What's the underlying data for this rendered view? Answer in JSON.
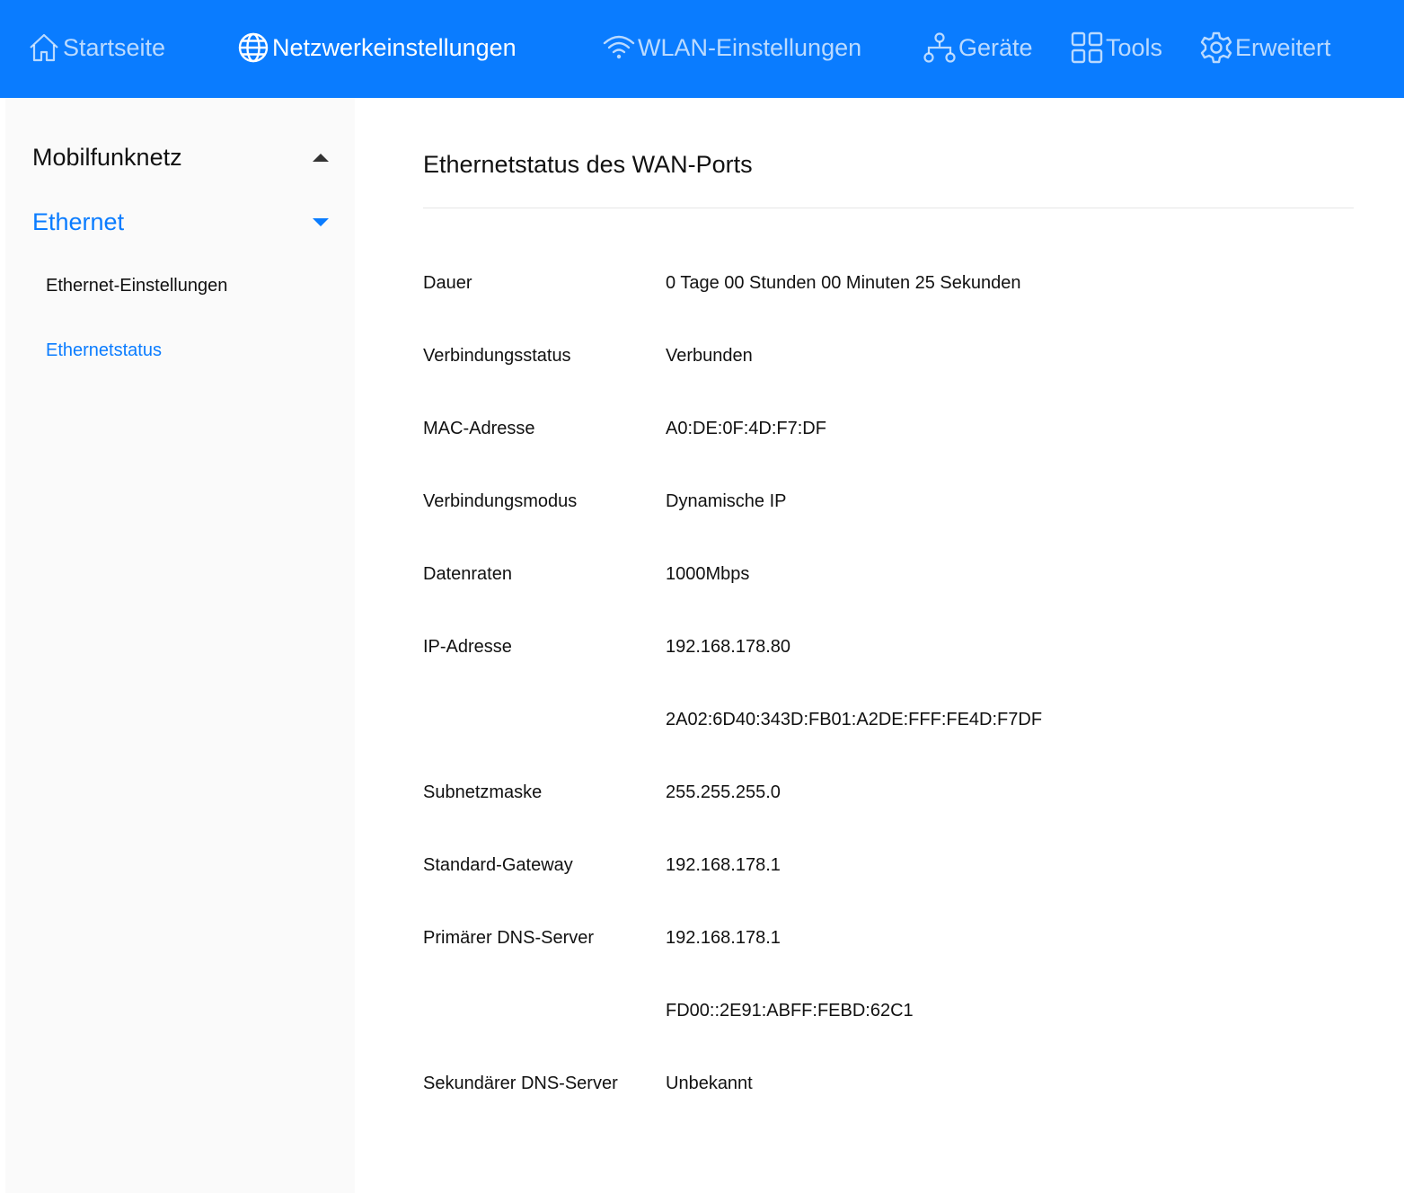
{
  "nav": {
    "items": [
      {
        "label": "Startseite",
        "icon": "home-icon"
      },
      {
        "label": "Netzwerkeinstellungen",
        "icon": "globe-icon"
      },
      {
        "label": "WLAN-Einstellungen",
        "icon": "wifi-icon"
      },
      {
        "label": "Geräte",
        "icon": "devices-icon"
      },
      {
        "label": "Tools",
        "icon": "grid-icon"
      },
      {
        "label": "Erweitert",
        "icon": "gear-icon"
      }
    ],
    "active": "Netzwerkeinstellungen"
  },
  "sidebar": {
    "groups": [
      {
        "label": "Mobilfunknetz",
        "expanded": false
      },
      {
        "label": "Ethernet",
        "expanded": true
      }
    ],
    "subitems": [
      {
        "label": "Ethernet-Einstellungen"
      },
      {
        "label": "Ethernetstatus"
      }
    ],
    "active": "Ethernetstatus"
  },
  "main": {
    "title": "Ethernetstatus des WAN-Ports",
    "rows": [
      {
        "key": "Dauer",
        "value": "0 Tage 00 Stunden 00 Minuten 25 Sekunden"
      },
      {
        "key": "Verbindungsstatus",
        "value": "Verbunden"
      },
      {
        "key": "MAC-Adresse",
        "value": "A0:DE:0F:4D:F7:DF"
      },
      {
        "key": "Verbindungsmodus",
        "value": "Dynamische IP"
      },
      {
        "key": "Datenraten",
        "value": "1000Mbps"
      },
      {
        "key": "IP-Adresse",
        "value": "192.168.178.80"
      },
      {
        "key": "",
        "value": "2A02:6D40:343D:FB01:A2DE:FFF:FE4D:F7DF"
      },
      {
        "key": "Subnetzmaske",
        "value": "255.255.255.0"
      },
      {
        "key": "Standard-Gateway",
        "value": "192.168.178.1"
      },
      {
        "key": "Primärer DNS-Server",
        "value": "192.168.178.1"
      },
      {
        "key": "",
        "value": "FD00::2E91:ABFF:FEBD:62C1"
      },
      {
        "key": "Sekundärer DNS-Server",
        "value": "Unbekannt"
      }
    ]
  },
  "colors": {
    "accent": "#0a7cff",
    "topbar": "#0a7cff",
    "sidebar_bg": "#fafafa"
  }
}
